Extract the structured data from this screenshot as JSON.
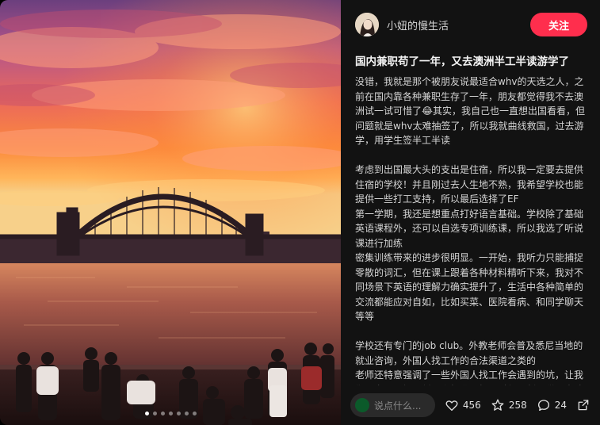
{
  "author": {
    "name": "小妞的慢生活"
  },
  "follow_label": "关注",
  "post": {
    "title": "国内兼职苟了一年，又去澳洲半工半读游学了",
    "paragraphs": [
      "没错，我就是那个被朋友说最适合whv的天选之人，之前在国内靠各种兼职生存了一年，朋友都觉得我不去澳洲试一试可惜了😂其实，我自己也一直想出国看看，但问题就是whv太难抽签了，所以我就曲线救国，过去游学，用学生签半工半读",
      "",
      "考虑到出国最大头的支出是住宿，所以我一定要去提供住宿的学校！并且刚过去人生地不熟，我希望学校也能提供一些打工支持，所以最后选择了EF",
      "第一学期，我还是想重点打好语言基础。学校除了基础英语课程外，还可以自选专项训练课，所以我选了听说课进行加练",
      "密集训练带来的进步很明显。一开始，我听力只能捕捉零散的词汇，但在课上跟着各种材料精听下来，我对不同场景下英语的理解力确实提升了，生活中各种简单的交流都能应对自如，比如买菜、医院看病、和同学聊天等等",
      "",
      "学校还有专门的job club。外教老师会普及悉尼当地的就业咨询，外国人找工作的合法渠道之类的",
      "老师还特意强调了一些外国人找工作会遇到的坑，让我们一定要了解最低工资标准、打工时长限制、税号申请"
    ]
  },
  "comment": {
    "placeholder": "说点什么..."
  },
  "stats": {
    "likes": "456",
    "collects": "258",
    "comments": "24"
  },
  "carousel": {
    "total": 7,
    "current": 1
  },
  "colors": {
    "accent": "#ff2e4d",
    "panel": "#121212"
  },
  "icons": {
    "like": "heart-icon",
    "collect": "star-icon",
    "comment": "comment-bubble-icon",
    "share": "share-icon"
  }
}
